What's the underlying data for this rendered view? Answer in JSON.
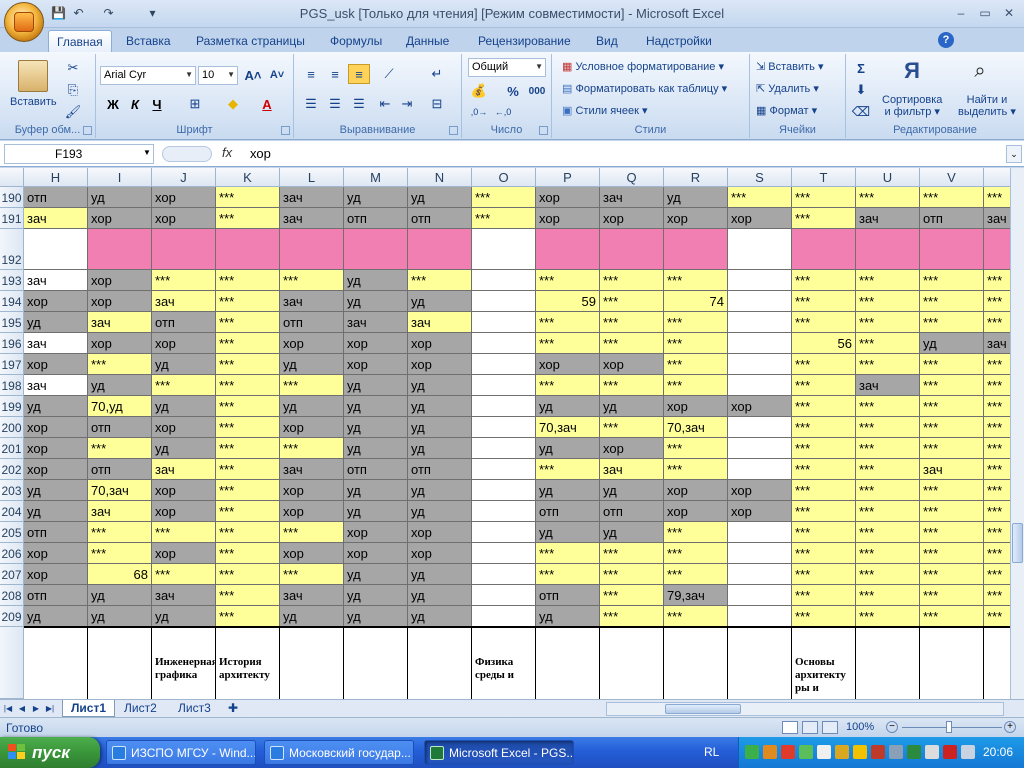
{
  "window": {
    "title": "PGS_usk  [Только для чтения]  [Режим совместимости] - Microsoft Excel",
    "controls": [
      "–",
      "▭",
      "✕"
    ]
  },
  "tabs": [
    "Главная",
    "Вставка",
    "Разметка страницы",
    "Формулы",
    "Данные",
    "Рецензирование",
    "Вид",
    "Надстройки"
  ],
  "ribbon": {
    "clipboard": {
      "paste_label": "Вставить",
      "group": "Буфер обм..."
    },
    "font": {
      "name": "Arial Cyr",
      "size": "10",
      "bold": "Ж",
      "italic": "К",
      "underline": "Ч",
      "group": "Шрифт"
    },
    "alignment": {
      "group": "Выравнивание"
    },
    "number": {
      "format": "Общий",
      "group": "Число",
      "percent": "%",
      "thousands": "000"
    },
    "styles": {
      "conditional": "Условное форматирование",
      "as_table": "Форматировать как таблицу",
      "cell_styles": "Стили ячеек",
      "group": "Стили"
    },
    "cells": {
      "insert": "Вставить",
      "delete": "Удалить",
      "format": "Формат",
      "group": "Ячейки"
    },
    "editing": {
      "sort": "Сортировка и фильтр",
      "sort1": "Сортировка",
      "sort2": "и фильтр",
      "find1": "Найти и",
      "find2": "выделить",
      "group": "Редактирование"
    }
  },
  "formula_bar": {
    "name_box": "F193",
    "fx": "fx",
    "content": "хор"
  },
  "columns": [
    "H",
    "I",
    "J",
    "K",
    "L",
    "M",
    "N",
    "O",
    "P",
    "Q",
    "R",
    "S",
    "T",
    "U",
    "V",
    ""
  ],
  "rows": [
    {
      "n": "190",
      "cells": [
        [
          "отп",
          "g"
        ],
        [
          "уд",
          "g"
        ],
        [
          "хор",
          "g"
        ],
        [
          "***",
          "y"
        ],
        [
          "зач",
          "g"
        ],
        [
          "уд",
          "g"
        ],
        [
          "уд",
          "g"
        ],
        [
          "***",
          "y"
        ],
        [
          "хор",
          "g"
        ],
        [
          "зач",
          "g"
        ],
        [
          "уд",
          "g"
        ],
        [
          "***",
          "y"
        ],
        [
          "***",
          "y"
        ],
        [
          "***",
          "y"
        ],
        [
          "***",
          "y"
        ],
        [
          "***",
          "y"
        ]
      ]
    },
    {
      "n": "191",
      "cells": [
        [
          "зач",
          "y"
        ],
        [
          "хор",
          "g"
        ],
        [
          "хор",
          "g"
        ],
        [
          "***",
          "y"
        ],
        [
          "зач",
          "g"
        ],
        [
          "отп",
          "g"
        ],
        [
          "отп",
          "g"
        ],
        [
          "***",
          "y"
        ],
        [
          "хор",
          "g"
        ],
        [
          "хор",
          "g"
        ],
        [
          "хор",
          "g"
        ],
        [
          "хор",
          "g"
        ],
        [
          "***",
          "y"
        ],
        [
          "зач",
          "g"
        ],
        [
          "отп",
          "g"
        ],
        [
          "зач",
          "g"
        ]
      ]
    },
    {
      "n": "192",
      "cells": [
        [
          "",
          "w"
        ],
        [
          "",
          "p"
        ],
        [
          "",
          "p"
        ],
        [
          "",
          "p"
        ],
        [
          "",
          "p"
        ],
        [
          "",
          "p"
        ],
        [
          "",
          "p"
        ],
        [
          "",
          "w"
        ],
        [
          "",
          "p"
        ],
        [
          "",
          "p"
        ],
        [
          "",
          "p"
        ],
        [
          "",
          "w"
        ],
        [
          "",
          "p"
        ],
        [
          "",
          "p"
        ],
        [
          "",
          "p"
        ],
        [
          "",
          "p"
        ]
      ]
    },
    {
      "n": "193",
      "cells": [
        [
          "зач",
          "w"
        ],
        [
          "хор",
          "g"
        ],
        [
          "***",
          "y"
        ],
        [
          "***",
          "y"
        ],
        [
          "***",
          "y"
        ],
        [
          "уд",
          "g"
        ],
        [
          "***",
          "y"
        ],
        [
          "",
          "w"
        ],
        [
          "***",
          "y"
        ],
        [
          "***",
          "y"
        ],
        [
          "***",
          "y"
        ],
        [
          "",
          "w"
        ],
        [
          "***",
          "y"
        ],
        [
          "***",
          "y"
        ],
        [
          "***",
          "y"
        ],
        [
          "***",
          "y"
        ]
      ]
    },
    {
      "n": "194",
      "cells": [
        [
          "хор",
          "g"
        ],
        [
          "хор",
          "g"
        ],
        [
          "зач",
          "y"
        ],
        [
          "***",
          "y"
        ],
        [
          "зач",
          "g"
        ],
        [
          "уд",
          "g"
        ],
        [
          "уд",
          "g"
        ],
        [
          "",
          "w"
        ],
        [
          "59",
          "y"
        ],
        [
          "***",
          "y"
        ],
        [
          "74",
          "y"
        ],
        [
          "",
          "w"
        ],
        [
          "***",
          "y"
        ],
        [
          "***",
          "y"
        ],
        [
          "***",
          "y"
        ],
        [
          "***",
          "y"
        ]
      ]
    },
    {
      "n": "195",
      "cells": [
        [
          "уд",
          "g"
        ],
        [
          "зач",
          "y"
        ],
        [
          "отп",
          "g"
        ],
        [
          "***",
          "y"
        ],
        [
          "отп",
          "g"
        ],
        [
          "зач",
          "g"
        ],
        [
          "зач",
          "y"
        ],
        [
          "",
          "w"
        ],
        [
          "***",
          "y"
        ],
        [
          "***",
          "y"
        ],
        [
          "***",
          "y"
        ],
        [
          "",
          "w"
        ],
        [
          "***",
          "y"
        ],
        [
          "***",
          "y"
        ],
        [
          "***",
          "y"
        ],
        [
          "***",
          "y"
        ]
      ]
    },
    {
      "n": "196",
      "cells": [
        [
          "зач",
          "w"
        ],
        [
          "хор",
          "g"
        ],
        [
          "хор",
          "g"
        ],
        [
          "***",
          "y"
        ],
        [
          "хор",
          "g"
        ],
        [
          "хор",
          "g"
        ],
        [
          "хор",
          "g"
        ],
        [
          "",
          "w"
        ],
        [
          "***",
          "y"
        ],
        [
          "***",
          "y"
        ],
        [
          "***",
          "y"
        ],
        [
          "",
          "w"
        ],
        [
          "56",
          "y"
        ],
        [
          "***",
          "y"
        ],
        [
          "уд",
          "g"
        ],
        [
          "зач",
          "g"
        ]
      ]
    },
    {
      "n": "197",
      "cells": [
        [
          "хор",
          "g"
        ],
        [
          "***",
          "y"
        ],
        [
          "уд",
          "g"
        ],
        [
          "***",
          "y"
        ],
        [
          "уд",
          "g"
        ],
        [
          "хор",
          "g"
        ],
        [
          "хор",
          "g"
        ],
        [
          "",
          "w"
        ],
        [
          "хор",
          "g"
        ],
        [
          "хор",
          "g"
        ],
        [
          "***",
          "y"
        ],
        [
          "",
          "w"
        ],
        [
          "***",
          "y"
        ],
        [
          "***",
          "y"
        ],
        [
          "***",
          "y"
        ],
        [
          "***",
          "y"
        ]
      ]
    },
    {
      "n": "198",
      "cells": [
        [
          "зач",
          "w"
        ],
        [
          "уд",
          "g"
        ],
        [
          "***",
          "y"
        ],
        [
          "***",
          "y"
        ],
        [
          "***",
          "y"
        ],
        [
          "уд",
          "g"
        ],
        [
          "уд",
          "g"
        ],
        [
          "",
          "w"
        ],
        [
          "***",
          "y"
        ],
        [
          "***",
          "y"
        ],
        [
          "***",
          "y"
        ],
        [
          "",
          "w"
        ],
        [
          "***",
          "y"
        ],
        [
          "зач",
          "g"
        ],
        [
          "***",
          "y"
        ],
        [
          "***",
          "y"
        ]
      ]
    },
    {
      "n": "199",
      "cells": [
        [
          "уд",
          "g"
        ],
        [
          "70,уд",
          "y"
        ],
        [
          "уд",
          "g"
        ],
        [
          "***",
          "y"
        ],
        [
          "уд",
          "g"
        ],
        [
          "уд",
          "g"
        ],
        [
          "уд",
          "g"
        ],
        [
          "",
          "w"
        ],
        [
          "уд",
          "g"
        ],
        [
          "уд",
          "g"
        ],
        [
          "хор",
          "g"
        ],
        [
          "хор",
          "g"
        ],
        [
          "***",
          "y"
        ],
        [
          "***",
          "y"
        ],
        [
          "***",
          "y"
        ],
        [
          "***",
          "y"
        ]
      ]
    },
    {
      "n": "200",
      "cells": [
        [
          "хор",
          "g"
        ],
        [
          "отп",
          "g"
        ],
        [
          "хор",
          "g"
        ],
        [
          "***",
          "y"
        ],
        [
          "хор",
          "g"
        ],
        [
          "уд",
          "g"
        ],
        [
          "уд",
          "g"
        ],
        [
          "",
          "w"
        ],
        [
          "70,зач",
          "y"
        ],
        [
          "***",
          "y"
        ],
        [
          "70,зач",
          "y"
        ],
        [
          "",
          "w"
        ],
        [
          "***",
          "y"
        ],
        [
          "***",
          "y"
        ],
        [
          "***",
          "y"
        ],
        [
          "***",
          "y"
        ]
      ]
    },
    {
      "n": "201",
      "cells": [
        [
          "хор",
          "g"
        ],
        [
          "***",
          "y"
        ],
        [
          "уд",
          "g"
        ],
        [
          "***",
          "y"
        ],
        [
          "***",
          "y"
        ],
        [
          "уд",
          "g"
        ],
        [
          "уд",
          "g"
        ],
        [
          "",
          "w"
        ],
        [
          "уд",
          "g"
        ],
        [
          "хор",
          "g"
        ],
        [
          "***",
          "y"
        ],
        [
          "",
          "w"
        ],
        [
          "***",
          "y"
        ],
        [
          "***",
          "y"
        ],
        [
          "***",
          "y"
        ],
        [
          "***",
          "y"
        ]
      ]
    },
    {
      "n": "202",
      "cells": [
        [
          "хор",
          "g"
        ],
        [
          "отп",
          "g"
        ],
        [
          "зач",
          "y"
        ],
        [
          "***",
          "y"
        ],
        [
          "зач",
          "g"
        ],
        [
          "отп",
          "g"
        ],
        [
          "отп",
          "g"
        ],
        [
          "",
          "w"
        ],
        [
          "***",
          "y"
        ],
        [
          "зач",
          "y"
        ],
        [
          "***",
          "y"
        ],
        [
          "",
          "w"
        ],
        [
          "***",
          "y"
        ],
        [
          "***",
          "y"
        ],
        [
          "зач",
          "y"
        ],
        [
          "***",
          "y"
        ]
      ]
    },
    {
      "n": "203",
      "cells": [
        [
          "уд",
          "g"
        ],
        [
          "70,зач",
          "y"
        ],
        [
          "хор",
          "g"
        ],
        [
          "***",
          "y"
        ],
        [
          "хор",
          "g"
        ],
        [
          "уд",
          "g"
        ],
        [
          "уд",
          "g"
        ],
        [
          "",
          "w"
        ],
        [
          "уд",
          "g"
        ],
        [
          "уд",
          "g"
        ],
        [
          "хор",
          "g"
        ],
        [
          "хор",
          "g"
        ],
        [
          "***",
          "y"
        ],
        [
          "***",
          "y"
        ],
        [
          "***",
          "y"
        ],
        [
          "***",
          "y"
        ]
      ]
    },
    {
      "n": "204",
      "cells": [
        [
          "уд",
          "g"
        ],
        [
          "зач",
          "y"
        ],
        [
          "хор",
          "g"
        ],
        [
          "***",
          "y"
        ],
        [
          "хор",
          "g"
        ],
        [
          "уд",
          "g"
        ],
        [
          "уд",
          "g"
        ],
        [
          "",
          "w"
        ],
        [
          "отп",
          "g"
        ],
        [
          "отп",
          "g"
        ],
        [
          "хор",
          "g"
        ],
        [
          "хор",
          "g"
        ],
        [
          "***",
          "y"
        ],
        [
          "***",
          "y"
        ],
        [
          "***",
          "y"
        ],
        [
          "***",
          "y"
        ]
      ]
    },
    {
      "n": "205",
      "cells": [
        [
          "отп",
          "g"
        ],
        [
          "***",
          "y"
        ],
        [
          "***",
          "y"
        ],
        [
          "***",
          "y"
        ],
        [
          "***",
          "y"
        ],
        [
          "хор",
          "g"
        ],
        [
          "хор",
          "g"
        ],
        [
          "",
          "w"
        ],
        [
          "уд",
          "g"
        ],
        [
          "уд",
          "g"
        ],
        [
          "***",
          "y"
        ],
        [
          "",
          "w"
        ],
        [
          "***",
          "y"
        ],
        [
          "***",
          "y"
        ],
        [
          "***",
          "y"
        ],
        [
          "***",
          "y"
        ]
      ]
    },
    {
      "n": "206",
      "cells": [
        [
          "хор",
          "g"
        ],
        [
          "***",
          "y"
        ],
        [
          "хор",
          "g"
        ],
        [
          "***",
          "y"
        ],
        [
          "хор",
          "g"
        ],
        [
          "хор",
          "g"
        ],
        [
          "хор",
          "g"
        ],
        [
          "",
          "w"
        ],
        [
          "***",
          "y"
        ],
        [
          "***",
          "y"
        ],
        [
          "***",
          "y"
        ],
        [
          "",
          "w"
        ],
        [
          "***",
          "y"
        ],
        [
          "***",
          "y"
        ],
        [
          "***",
          "y"
        ],
        [
          "***",
          "y"
        ]
      ]
    },
    {
      "n": "207",
      "cells": [
        [
          "хор",
          "g"
        ],
        [
          "68",
          "y"
        ],
        [
          "***",
          "y"
        ],
        [
          "***",
          "y"
        ],
        [
          "***",
          "y"
        ],
        [
          "уд",
          "g"
        ],
        [
          "уд",
          "g"
        ],
        [
          "",
          "w"
        ],
        [
          "***",
          "y"
        ],
        [
          "***",
          "y"
        ],
        [
          "***",
          "y"
        ],
        [
          "",
          "w"
        ],
        [
          "***",
          "y"
        ],
        [
          "***",
          "y"
        ],
        [
          "***",
          "y"
        ],
        [
          "***",
          "y"
        ]
      ]
    },
    {
      "n": "208",
      "cells": [
        [
          "отп",
          "g"
        ],
        [
          "уд",
          "g"
        ],
        [
          "зач",
          "g"
        ],
        [
          "***",
          "y"
        ],
        [
          "зач",
          "g"
        ],
        [
          "уд",
          "g"
        ],
        [
          "уд",
          "g"
        ],
        [
          "",
          "w"
        ],
        [
          "отп",
          "g"
        ],
        [
          "***",
          "y"
        ],
        [
          "79,зач",
          "g"
        ],
        [
          "",
          "w"
        ],
        [
          "***",
          "y"
        ],
        [
          "***",
          "y"
        ],
        [
          "***",
          "y"
        ],
        [
          "***",
          "y"
        ]
      ]
    },
    {
      "n": "209",
      "cells": [
        [
          "уд",
          "g"
        ],
        [
          "уд",
          "g"
        ],
        [
          "уд",
          "g"
        ],
        [
          "***",
          "y"
        ],
        [
          "уд",
          "g"
        ],
        [
          "уд",
          "g"
        ],
        [
          "уд",
          "g"
        ],
        [
          "",
          "w"
        ],
        [
          "уд",
          "g"
        ],
        [
          "***",
          "y"
        ],
        [
          "***",
          "y"
        ],
        [
          "",
          "w"
        ],
        [
          "***",
          "y"
        ],
        [
          "***",
          "y"
        ],
        [
          "***",
          "y"
        ],
        [
          "***",
          "y"
        ]
      ]
    }
  ],
  "subject_headers": [
    {
      "col": "J",
      "text": "Инженерная графика"
    },
    {
      "col": "K",
      "text": "История архитекту"
    },
    {
      "col": "O",
      "text": "Физика среды и"
    },
    {
      "col": "T",
      "text": "Основы архитекту ры и"
    }
  ],
  "sheets": [
    "Лист1",
    "Лист2",
    "Лист3"
  ],
  "status": {
    "ready": "Готово",
    "zoom": "100%"
  },
  "taskbar": {
    "start": "пуск",
    "tasks": [
      "ИЗСПО МГСУ - Wind...",
      "Московский государ...",
      "Microsoft Excel - PGS..."
    ],
    "lang": "RL",
    "time": "20:06"
  },
  "colors": {
    "yellow": "#ffff99",
    "gray": "#a6a6a6",
    "pink": "#f27fb1",
    "white": "#ffffff"
  }
}
